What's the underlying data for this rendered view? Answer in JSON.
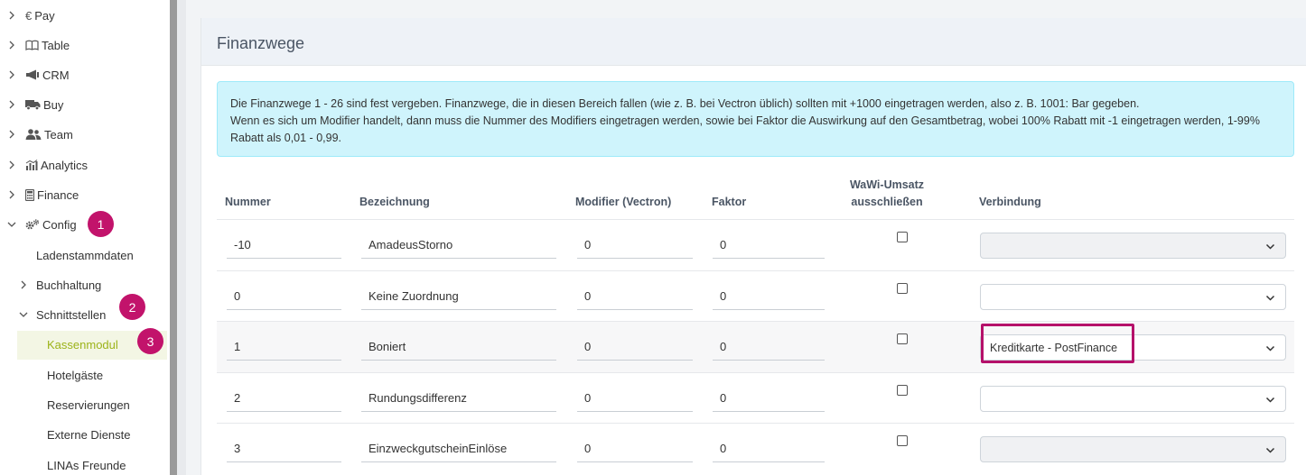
{
  "sidebar": {
    "items": [
      {
        "label": "Pay",
        "icon": "euro-icon"
      },
      {
        "label": "Table",
        "icon": "book-open-icon"
      },
      {
        "label": "CRM",
        "icon": "megaphone-icon"
      },
      {
        "label": "Buy",
        "icon": "truck-icon"
      },
      {
        "label": "Team",
        "icon": "users-icon"
      },
      {
        "label": "Analytics",
        "icon": "chart-icon"
      },
      {
        "label": "Finance",
        "icon": "calculator-icon"
      },
      {
        "label": "Config",
        "icon": "gears-icon"
      }
    ],
    "config_children": [
      "Ladenstammdaten",
      "Buchhaltung",
      "Schnittstellen"
    ],
    "schnittstellen_children": [
      "Kassenmodul",
      "Hotelgäste",
      "Reservierungen",
      "Externe Dienste",
      "LINAs Freunde"
    ],
    "badges": [
      "1",
      "2",
      "3"
    ]
  },
  "page": {
    "title": "Finanzwege",
    "alert_line1": "Die Finanzwege 1 - 26 sind fest vergeben. Finanzwege, die in diesen Bereich fallen (wie z. B. bei Vectron üblich) sollten mit +1000 eingetragen werden, also z. B. 1001: Bar gegeben.",
    "alert_line2": "Wenn es sich um Modifier handelt, dann muss die Nummer des Modifiers eingetragen werden, sowie bei Faktor die Auswirkung auf den Gesamtbetrag, wobei 100% Rabatt mit -1 eingetragen werden, 1-99% Rabatt als 0,01 - 0,99."
  },
  "table": {
    "headers": {
      "nummer": "Nummer",
      "bezeichnung": "Bezeichnung",
      "modifier": "Modifier (Vectron)",
      "faktor": "Faktor",
      "wawi_1": "WaWi-Umsatz",
      "wawi_2": "ausschließen",
      "verbindung": "Verbindung"
    },
    "rows": [
      {
        "nummer": "-10",
        "bezeichnung": "AmadeusStorno",
        "modifier": "0",
        "faktor": "0",
        "verbindung": ""
      },
      {
        "nummer": "0",
        "bezeichnung": "Keine Zuordnung",
        "modifier": "0",
        "faktor": "0",
        "verbindung": ""
      },
      {
        "nummer": "1",
        "bezeichnung": "Boniert",
        "modifier": "0",
        "faktor": "0",
        "verbindung": "Kreditkarte - PostFinance"
      },
      {
        "nummer": "2",
        "bezeichnung": "Rundungsdifferenz",
        "modifier": "0",
        "faktor": "0",
        "verbindung": ""
      },
      {
        "nummer": "3",
        "bezeichnung": "EinzweckgutscheinEinlöse",
        "modifier": "0",
        "faktor": "0",
        "verbindung": ""
      }
    ]
  },
  "colors": {
    "accent": "#9cb31a",
    "badge": "#c2136b",
    "highlight": "#b5116a",
    "alert_bg": "#cff4fc"
  }
}
